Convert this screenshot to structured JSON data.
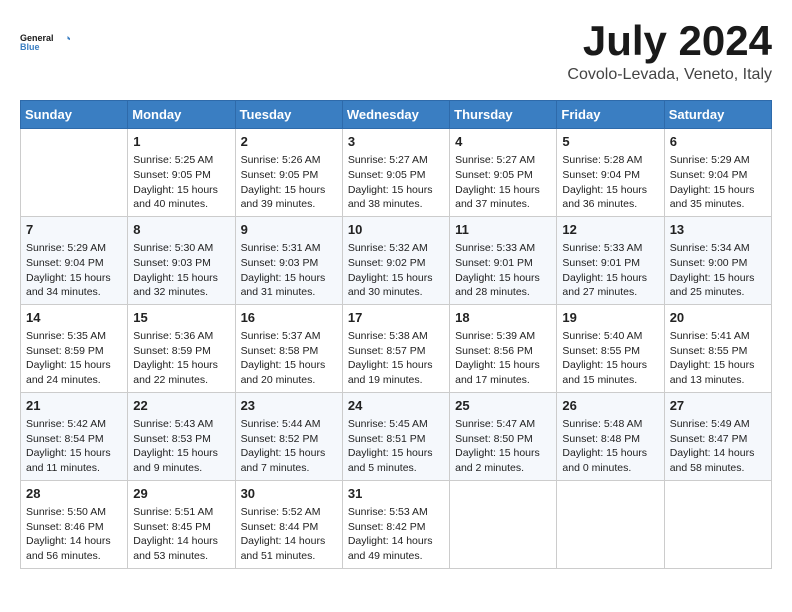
{
  "header": {
    "logo_line1": "General",
    "logo_line2": "Blue",
    "month": "July 2024",
    "location": "Covolo-Levada, Veneto, Italy"
  },
  "columns": [
    "Sunday",
    "Monday",
    "Tuesday",
    "Wednesday",
    "Thursday",
    "Friday",
    "Saturday"
  ],
  "weeks": [
    [
      {
        "day": "",
        "info": ""
      },
      {
        "day": "1",
        "info": "Sunrise: 5:25 AM\nSunset: 9:05 PM\nDaylight: 15 hours\nand 40 minutes."
      },
      {
        "day": "2",
        "info": "Sunrise: 5:26 AM\nSunset: 9:05 PM\nDaylight: 15 hours\nand 39 minutes."
      },
      {
        "day": "3",
        "info": "Sunrise: 5:27 AM\nSunset: 9:05 PM\nDaylight: 15 hours\nand 38 minutes."
      },
      {
        "day": "4",
        "info": "Sunrise: 5:27 AM\nSunset: 9:05 PM\nDaylight: 15 hours\nand 37 minutes."
      },
      {
        "day": "5",
        "info": "Sunrise: 5:28 AM\nSunset: 9:04 PM\nDaylight: 15 hours\nand 36 minutes."
      },
      {
        "day": "6",
        "info": "Sunrise: 5:29 AM\nSunset: 9:04 PM\nDaylight: 15 hours\nand 35 minutes."
      }
    ],
    [
      {
        "day": "7",
        "info": "Sunrise: 5:29 AM\nSunset: 9:04 PM\nDaylight: 15 hours\nand 34 minutes."
      },
      {
        "day": "8",
        "info": "Sunrise: 5:30 AM\nSunset: 9:03 PM\nDaylight: 15 hours\nand 32 minutes."
      },
      {
        "day": "9",
        "info": "Sunrise: 5:31 AM\nSunset: 9:03 PM\nDaylight: 15 hours\nand 31 minutes."
      },
      {
        "day": "10",
        "info": "Sunrise: 5:32 AM\nSunset: 9:02 PM\nDaylight: 15 hours\nand 30 minutes."
      },
      {
        "day": "11",
        "info": "Sunrise: 5:33 AM\nSunset: 9:01 PM\nDaylight: 15 hours\nand 28 minutes."
      },
      {
        "day": "12",
        "info": "Sunrise: 5:33 AM\nSunset: 9:01 PM\nDaylight: 15 hours\nand 27 minutes."
      },
      {
        "day": "13",
        "info": "Sunrise: 5:34 AM\nSunset: 9:00 PM\nDaylight: 15 hours\nand 25 minutes."
      }
    ],
    [
      {
        "day": "14",
        "info": "Sunrise: 5:35 AM\nSunset: 8:59 PM\nDaylight: 15 hours\nand 24 minutes."
      },
      {
        "day": "15",
        "info": "Sunrise: 5:36 AM\nSunset: 8:59 PM\nDaylight: 15 hours\nand 22 minutes."
      },
      {
        "day": "16",
        "info": "Sunrise: 5:37 AM\nSunset: 8:58 PM\nDaylight: 15 hours\nand 20 minutes."
      },
      {
        "day": "17",
        "info": "Sunrise: 5:38 AM\nSunset: 8:57 PM\nDaylight: 15 hours\nand 19 minutes."
      },
      {
        "day": "18",
        "info": "Sunrise: 5:39 AM\nSunset: 8:56 PM\nDaylight: 15 hours\nand 17 minutes."
      },
      {
        "day": "19",
        "info": "Sunrise: 5:40 AM\nSunset: 8:55 PM\nDaylight: 15 hours\nand 15 minutes."
      },
      {
        "day": "20",
        "info": "Sunrise: 5:41 AM\nSunset: 8:55 PM\nDaylight: 15 hours\nand 13 minutes."
      }
    ],
    [
      {
        "day": "21",
        "info": "Sunrise: 5:42 AM\nSunset: 8:54 PM\nDaylight: 15 hours\nand 11 minutes."
      },
      {
        "day": "22",
        "info": "Sunrise: 5:43 AM\nSunset: 8:53 PM\nDaylight: 15 hours\nand 9 minutes."
      },
      {
        "day": "23",
        "info": "Sunrise: 5:44 AM\nSunset: 8:52 PM\nDaylight: 15 hours\nand 7 minutes."
      },
      {
        "day": "24",
        "info": "Sunrise: 5:45 AM\nSunset: 8:51 PM\nDaylight: 15 hours\nand 5 minutes."
      },
      {
        "day": "25",
        "info": "Sunrise: 5:47 AM\nSunset: 8:50 PM\nDaylight: 15 hours\nand 2 minutes."
      },
      {
        "day": "26",
        "info": "Sunrise: 5:48 AM\nSunset: 8:48 PM\nDaylight: 15 hours\nand 0 minutes."
      },
      {
        "day": "27",
        "info": "Sunrise: 5:49 AM\nSunset: 8:47 PM\nDaylight: 14 hours\nand 58 minutes."
      }
    ],
    [
      {
        "day": "28",
        "info": "Sunrise: 5:50 AM\nSunset: 8:46 PM\nDaylight: 14 hours\nand 56 minutes."
      },
      {
        "day": "29",
        "info": "Sunrise: 5:51 AM\nSunset: 8:45 PM\nDaylight: 14 hours\nand 53 minutes."
      },
      {
        "day": "30",
        "info": "Sunrise: 5:52 AM\nSunset: 8:44 PM\nDaylight: 14 hours\nand 51 minutes."
      },
      {
        "day": "31",
        "info": "Sunrise: 5:53 AM\nSunset: 8:42 PM\nDaylight: 14 hours\nand 49 minutes."
      },
      {
        "day": "",
        "info": ""
      },
      {
        "day": "",
        "info": ""
      },
      {
        "day": "",
        "info": ""
      }
    ]
  ]
}
